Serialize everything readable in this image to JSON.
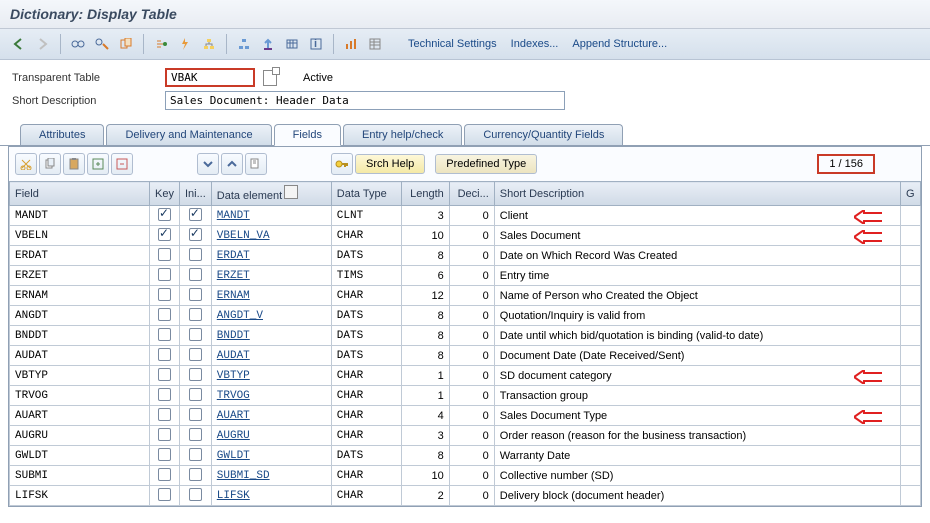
{
  "title": "Dictionary: Display Table",
  "toolbar_links": {
    "tech": "Technical Settings",
    "indexes": "Indexes...",
    "append": "Append Structure..."
  },
  "form": {
    "table_label": "Transparent Table",
    "table_value": "VBAK",
    "status": "Active",
    "desc_label": "Short Description",
    "desc_value": "Sales Document: Header Data"
  },
  "tabs": {
    "attr": "Attributes",
    "deliv": "Delivery and Maintenance",
    "fields": "Fields",
    "entry": "Entry help/check",
    "curr": "Currency/Quantity Fields"
  },
  "panel_toolbar": {
    "srch": "Srch Help",
    "predef": "Predefined Type",
    "counter": "1  /  156"
  },
  "grid": {
    "headers": {
      "field": "Field",
      "key": "Key",
      "ini": "Ini...",
      "elem": "Data element",
      "dtype": "Data Type",
      "len": "Length",
      "dec": "Deci...",
      "desc": "Short Description",
      "g": "G"
    },
    "rows": [
      {
        "field": "MANDT",
        "key": true,
        "ini": true,
        "elem": "MANDT",
        "dtype": "CLNT",
        "len": 3,
        "dec": 0,
        "desc": "Client",
        "arrow": true
      },
      {
        "field": "VBELN",
        "key": true,
        "ini": true,
        "elem": "VBELN_VA",
        "dtype": "CHAR",
        "len": 10,
        "dec": 0,
        "desc": "Sales Document",
        "arrow": true
      },
      {
        "field": "ERDAT",
        "key": false,
        "ini": false,
        "elem": "ERDAT",
        "dtype": "DATS",
        "len": 8,
        "dec": 0,
        "desc": "Date on Which Record Was Created"
      },
      {
        "field": "ERZET",
        "key": false,
        "ini": false,
        "elem": "ERZET",
        "dtype": "TIMS",
        "len": 6,
        "dec": 0,
        "desc": "Entry time"
      },
      {
        "field": "ERNAM",
        "key": false,
        "ini": false,
        "elem": "ERNAM",
        "dtype": "CHAR",
        "len": 12,
        "dec": 0,
        "desc": "Name of Person who Created the Object"
      },
      {
        "field": "ANGDT",
        "key": false,
        "ini": false,
        "elem": "ANGDT_V",
        "dtype": "DATS",
        "len": 8,
        "dec": 0,
        "desc": "Quotation/Inquiry is valid from"
      },
      {
        "field": "BNDDT",
        "key": false,
        "ini": false,
        "elem": "BNDDT",
        "dtype": "DATS",
        "len": 8,
        "dec": 0,
        "desc": "Date until which bid/quotation is binding (valid-to date)"
      },
      {
        "field": "AUDAT",
        "key": false,
        "ini": false,
        "elem": "AUDAT",
        "dtype": "DATS",
        "len": 8,
        "dec": 0,
        "desc": "Document Date (Date Received/Sent)"
      },
      {
        "field": "VBTYP",
        "key": false,
        "ini": false,
        "elem": "VBTYP",
        "dtype": "CHAR",
        "len": 1,
        "dec": 0,
        "desc": "SD document category",
        "arrow": true
      },
      {
        "field": "TRVOG",
        "key": false,
        "ini": false,
        "elem": "TRVOG",
        "dtype": "CHAR",
        "len": 1,
        "dec": 0,
        "desc": "Transaction group"
      },
      {
        "field": "AUART",
        "key": false,
        "ini": false,
        "elem": "AUART",
        "dtype": "CHAR",
        "len": 4,
        "dec": 0,
        "desc": "Sales Document Type",
        "arrow": true
      },
      {
        "field": "AUGRU",
        "key": false,
        "ini": false,
        "elem": "AUGRU",
        "dtype": "CHAR",
        "len": 3,
        "dec": 0,
        "desc": "Order reason (reason for the business transaction)"
      },
      {
        "field": "GWLDT",
        "key": false,
        "ini": false,
        "elem": "GWLDT",
        "dtype": "DATS",
        "len": 8,
        "dec": 0,
        "desc": "Warranty Date"
      },
      {
        "field": "SUBMI",
        "key": false,
        "ini": false,
        "elem": "SUBMI_SD",
        "dtype": "CHAR",
        "len": 10,
        "dec": 0,
        "desc": "Collective number (SD)"
      },
      {
        "field": "LIFSK",
        "key": false,
        "ini": false,
        "elem": "LIFSK",
        "dtype": "CHAR",
        "len": 2,
        "dec": 0,
        "desc": "Delivery block (document header)"
      }
    ]
  }
}
